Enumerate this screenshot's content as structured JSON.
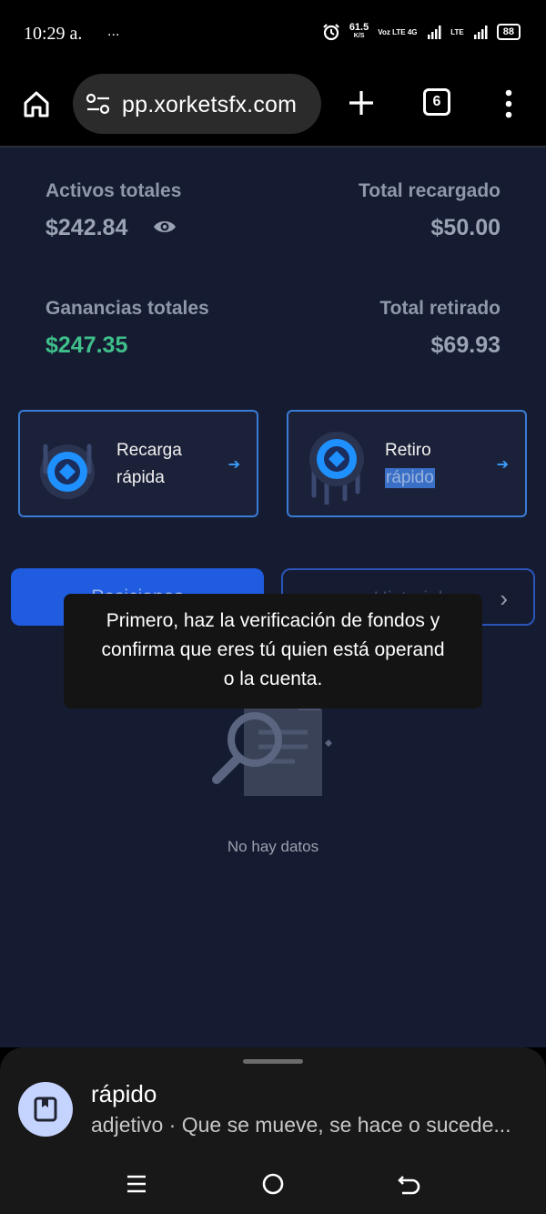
{
  "status_bar": {
    "time": "10:29 a.",
    "dots": "...",
    "speed_value": "61.5",
    "speed_unit": "K/S",
    "network_1": "Voz LTE 4G",
    "network_2": "LTE",
    "battery": "88"
  },
  "browser": {
    "url": "pp.xorketsfx.com",
    "tab_count": "6",
    "home_icon": "home-icon",
    "site_settings_icon": "tune-icon",
    "new_tab_icon": "plus-icon",
    "menu_icon": "more-vert-icon"
  },
  "stats": {
    "total_assets_label": "Activos totales",
    "total_assets_value": "$242.84",
    "total_recharged_label": "Total recargado",
    "total_recharged_value": "$50.00",
    "total_profit_label": "Ganancias totales",
    "total_profit_value": "$247.35",
    "total_withdrawn_label": "Total retirado",
    "total_withdrawn_value": "$69.93"
  },
  "actions": {
    "recharge_line1": "Recarga",
    "recharge_line2": "rápida",
    "withdraw_line1": "Retiro",
    "withdraw_line2": "rápido"
  },
  "tabs": {
    "positions": "Posiciones",
    "history": "Historial"
  },
  "toast": {
    "line1": "Primero, haz la verificación de fondos y",
    "line2": "confirma que eres tú quien está operand",
    "line3": "o la cuenta."
  },
  "empty_state": {
    "text": "No hay datos"
  },
  "definition_sheet": {
    "word": "rápido",
    "definition": "adjetivo · Que se mueve, se hace o sucede..."
  },
  "colors": {
    "background": "#151c32",
    "accent_blue": "#1f5ce0",
    "card_border": "#3a7bd5",
    "profit_green": "#3fbf8a"
  }
}
